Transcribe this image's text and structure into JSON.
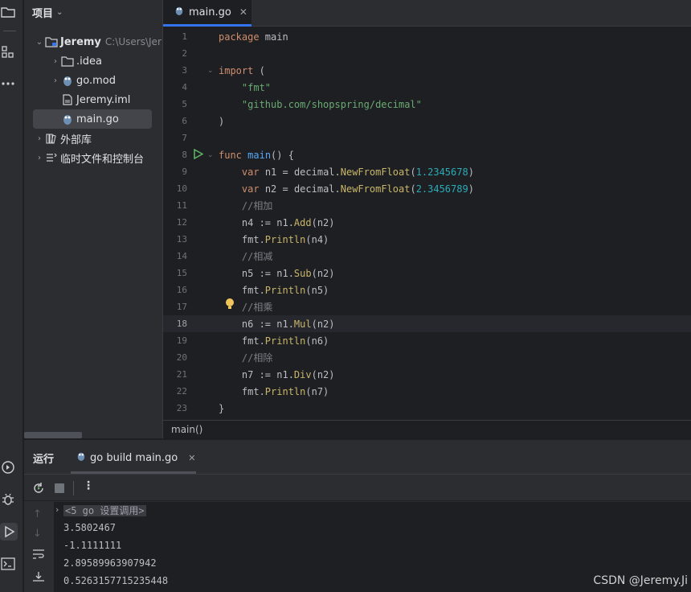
{
  "project_panel": {
    "title": "项目",
    "tree": [
      {
        "label": "Jeremy",
        "hint": "C:\\Users\\Jer",
        "type": "folder-root"
      },
      {
        "label": ".idea",
        "type": "folder"
      },
      {
        "label": "go.mod",
        "type": "gomod"
      },
      {
        "label": "Jeremy.iml",
        "type": "file"
      },
      {
        "label": "main.go",
        "type": "gofile",
        "selected": true
      },
      {
        "label": "外部库",
        "type": "library"
      },
      {
        "label": "临时文件和控制台",
        "type": "scratch"
      }
    ]
  },
  "editor": {
    "tab_label": "main.go",
    "current_line": 18,
    "breadcrumb": "main()",
    "lines": [
      "package main",
      "",
      "import (",
      "    \"fmt\"",
      "    \"github.com/shopspring/decimal\"",
      ")",
      "",
      "func main() {",
      "    var n1 = decimal.NewFromFloat(1.2345678)",
      "    var n2 = decimal.NewFromFloat(2.3456789)",
      "    //相加",
      "    n4 := n1.Add(n2)",
      "    fmt.Println(n4)",
      "    //相减",
      "    n5 := n1.Sub(n2)",
      "    fmt.Println(n5)",
      "    //相乘",
      "    n6 := n1.Mul(n2)",
      "    fmt.Println(n6)",
      "    //相除",
      "    n7 := n1.Div(n2)",
      "    fmt.Println(n7)",
      "}"
    ]
  },
  "run_panel": {
    "title": "运行",
    "tab_label": "go build main.go",
    "console_header": "<5 go 设置调用>",
    "output": [
      "3.5802467",
      "-1.1111111",
      "2.89589963907942",
      "0.5263157715235448"
    ]
  },
  "watermark": "CSDN @Jeremy.Ji",
  "colors": {
    "accent": "#3574f0",
    "keyword": "#cf8e6d",
    "string": "#6aab73",
    "number": "#2aacb8",
    "function": "#56a8f5"
  }
}
